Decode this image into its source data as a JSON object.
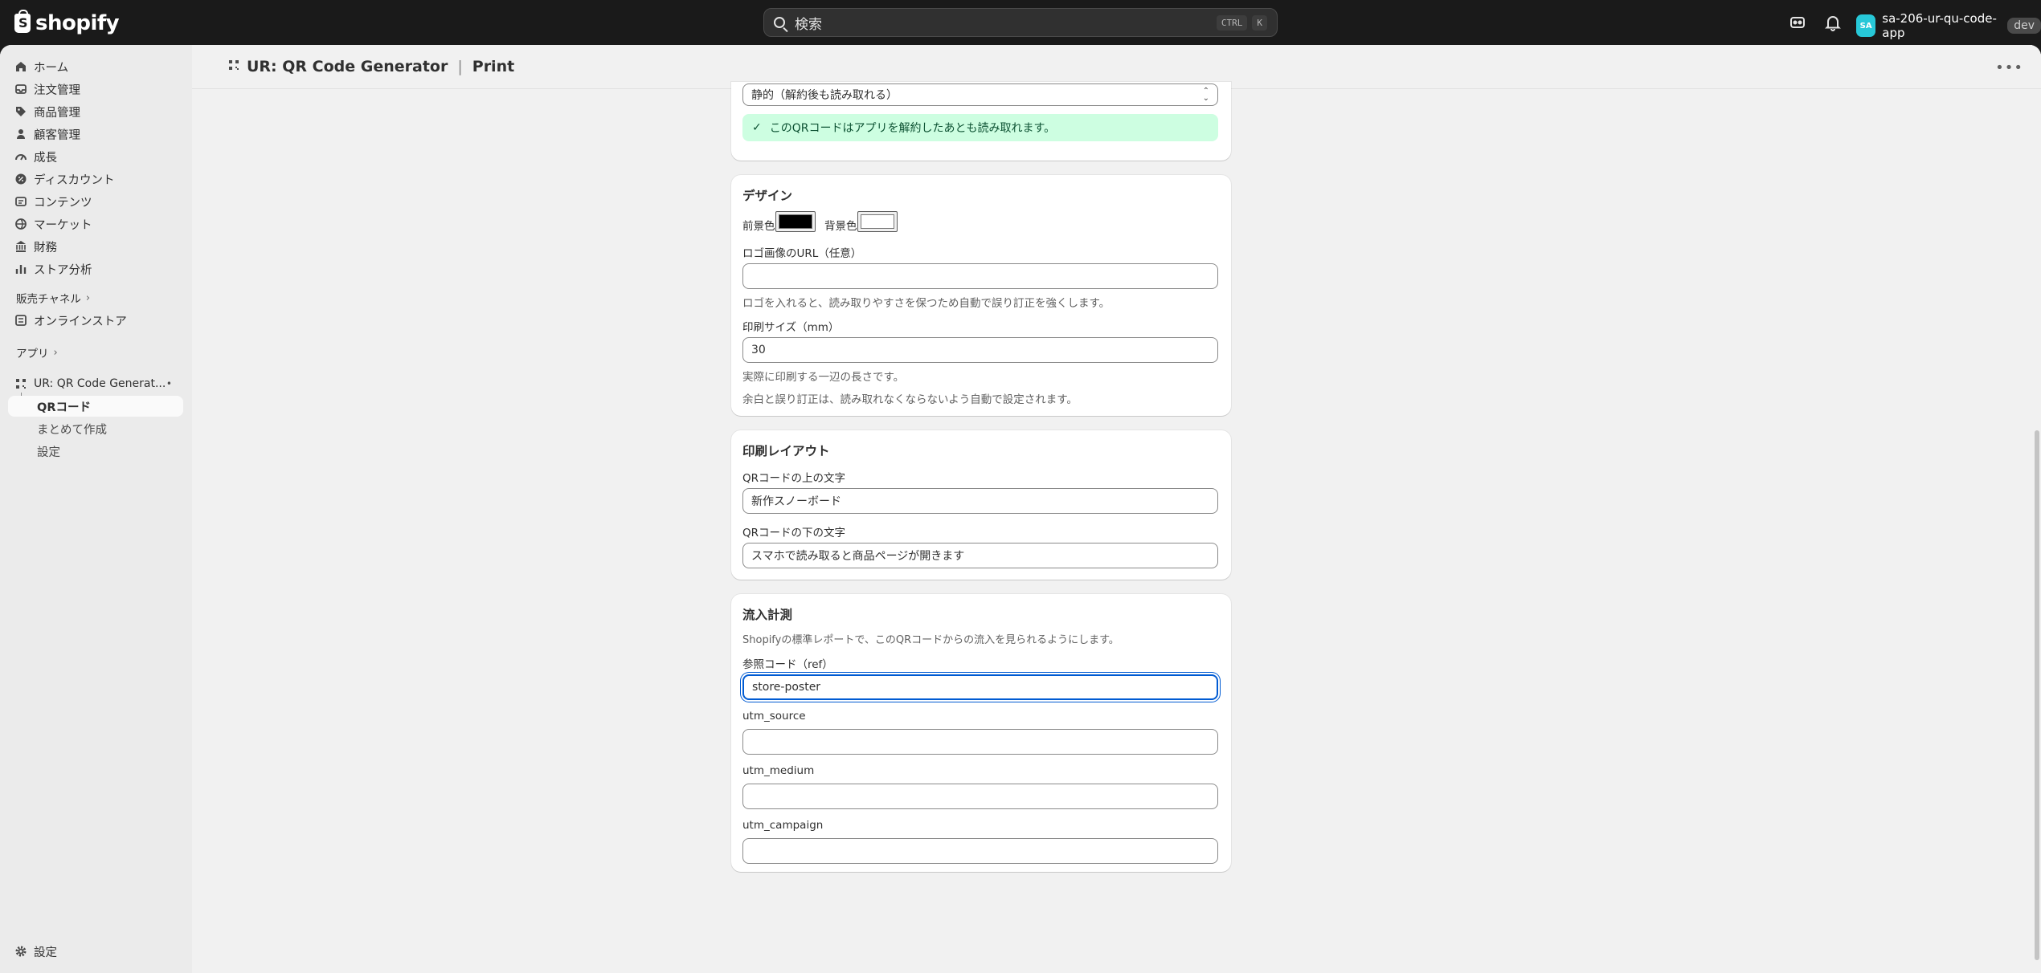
{
  "topbar": {
    "brand": "shopify",
    "search_placeholder": "検索",
    "shortcut_ctrl": "CTRL",
    "shortcut_key": "K",
    "store_initials": "SA",
    "store_name": "sa-206-ur-qu-code-app",
    "store_badge": "dev"
  },
  "sidebar": {
    "items": [
      {
        "label": "ホーム",
        "icon": "home-icon"
      },
      {
        "label": "注文管理",
        "icon": "inbox-icon"
      },
      {
        "label": "商品管理",
        "icon": "tag-icon"
      },
      {
        "label": "顧客管理",
        "icon": "person-icon"
      },
      {
        "label": "成長",
        "icon": "gauge-icon"
      },
      {
        "label": "ディスカウント",
        "icon": "discount-icon"
      },
      {
        "label": "コンテンツ",
        "icon": "content-icon"
      },
      {
        "label": "マーケット",
        "icon": "globe-icon"
      },
      {
        "label": "財務",
        "icon": "bank-icon"
      },
      {
        "label": "ストア分析",
        "icon": "chart-icon"
      }
    ],
    "sales_channels_label": "販売チャネル",
    "online_store_label": "オンラインストア",
    "apps_label": "アプリ",
    "app_name": "UR: QR Code Generat...",
    "app_subitems": [
      "QRコード",
      "まとめて作成",
      "設定"
    ],
    "settings_label": "設定"
  },
  "page": {
    "title_main": "UR: QR Code Generator",
    "title_sub": "Print"
  },
  "type_card": {
    "selected_value": "静的（解約後も読み取れる）",
    "banner_text": "このQRコードはアプリを解約したあとも読み取れます。"
  },
  "design_card": {
    "heading": "デザイン",
    "fg_label": "前景色",
    "bg_label": "背景色",
    "fg_color": "#000000",
    "bg_color": "#ffffff",
    "logo_label": "ロゴ画像のURL（任意）",
    "logo_value": "",
    "logo_help": "ロゴを入れると、読み取りやすさを保つため自動で誤り訂正を強くします。",
    "size_label": "印刷サイズ（mm）",
    "size_value": "30",
    "size_help1": "実際に印刷する一辺の長さです。",
    "size_help2": "余白と誤り訂正は、読み取れなくならないよう自動で設定されます。"
  },
  "layout_card": {
    "heading": "印刷レイアウト",
    "above_label": "QRコードの上の文字",
    "above_value": "新作スノーボード",
    "below_label": "QRコードの下の文字",
    "below_value": "スマホで読み取ると商品ページが開きます"
  },
  "tracking_card": {
    "heading": "流入計測",
    "description": "Shopifyの標準レポートで、このQRコードからの流入を見られるようにします。",
    "ref_label": "参照コード（ref）",
    "ref_value": "store-poster",
    "utm_source_label": "utm_source",
    "utm_source_value": "",
    "utm_medium_label": "utm_medium",
    "utm_medium_value": "",
    "utm_campaign_label": "utm_campaign",
    "utm_campaign_value": ""
  }
}
